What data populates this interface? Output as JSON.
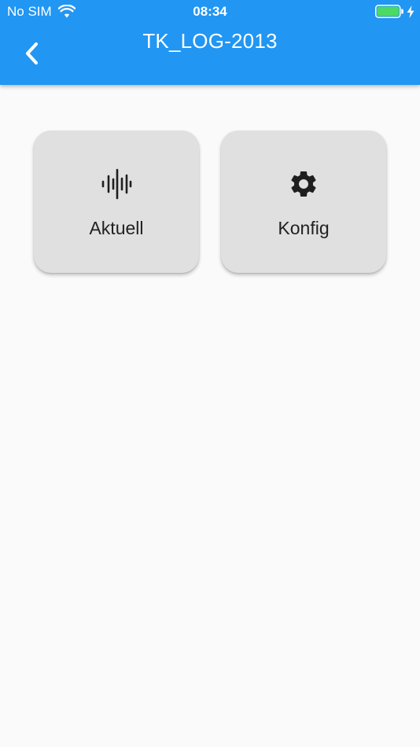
{
  "status_bar": {
    "carrier": "No SIM",
    "time": "08:34",
    "battery_color": "#4cd964"
  },
  "app_bar": {
    "title": "TK_LOG-2013",
    "color": "#2196f3",
    "back_icon": "chevron-left-icon"
  },
  "tiles": [
    {
      "label": "Aktuell",
      "icon": "waveform-icon"
    },
    {
      "label": "Konfig",
      "icon": "gear-icon"
    }
  ]
}
